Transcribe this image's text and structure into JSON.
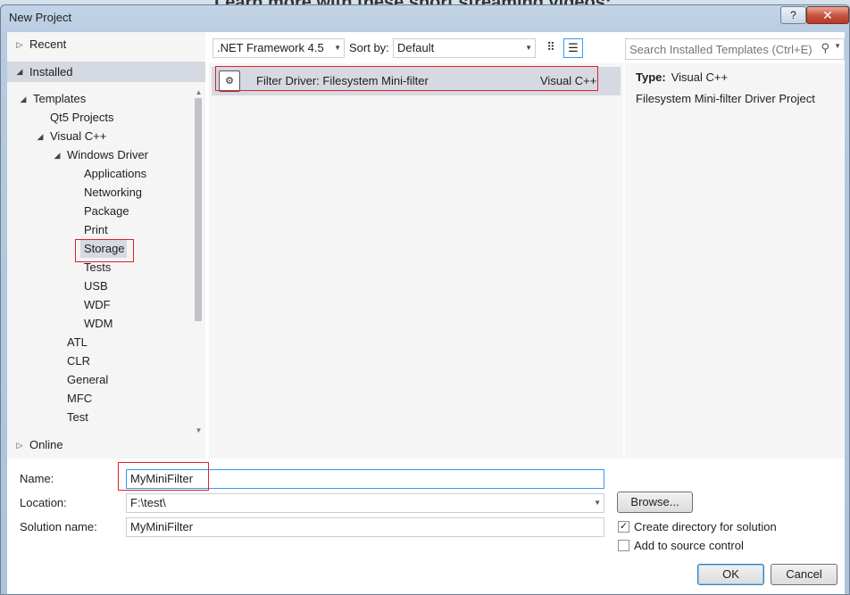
{
  "window": {
    "title": "New Project",
    "help_label": "?",
    "close_label": "✕"
  },
  "background": {
    "partial_text": "Learn more with these short streaming videos:"
  },
  "tree": {
    "recent": "Recent",
    "installed": "Installed",
    "online": "Online",
    "items": [
      {
        "label": "Templates",
        "expanded": true
      },
      {
        "label": "Qt5 Projects"
      },
      {
        "label": "Visual C++",
        "expanded": true
      },
      {
        "label": "Windows Driver",
        "expanded": true
      },
      {
        "label": "Applications"
      },
      {
        "label": "Networking"
      },
      {
        "label": "Package"
      },
      {
        "label": "Print"
      },
      {
        "label": "Storage",
        "selected": true
      },
      {
        "label": "Tests"
      },
      {
        "label": "USB"
      },
      {
        "label": "WDF"
      },
      {
        "label": "WDM"
      },
      {
        "label": "ATL"
      },
      {
        "label": "CLR"
      },
      {
        "label": "General"
      },
      {
        "label": "MFC"
      },
      {
        "label": "Test"
      }
    ]
  },
  "toolbar": {
    "framework": ".NET Framework 4.5",
    "sort_label": "Sort by:",
    "sort_value": "Default"
  },
  "templates": [
    {
      "name": "Filter Driver: Filesystem Mini-filter",
      "language": "Visual C++",
      "selected": true
    }
  ],
  "search": {
    "placeholder": "Search Installed Templates (Ctrl+E)"
  },
  "details": {
    "type_label": "Type:",
    "type_value": "Visual C++",
    "description": "Filesystem Mini-filter Driver Project"
  },
  "form": {
    "name_label": "Name:",
    "name_value": "MyMiniFilter",
    "location_label": "Location:",
    "location_value": "F:\\test\\",
    "solution_label": "Solution name:",
    "solution_value": "MyMiniFilter",
    "browse_label": "Browse...",
    "create_dir_label": "Create directory for solution",
    "create_dir_checked": true,
    "source_control_label": "Add to source control",
    "source_control_checked": false,
    "ok_label": "OK",
    "cancel_label": "Cancel"
  },
  "colors": {
    "highlight_box": "#e0202a",
    "selection": "#d5d9e2",
    "focus_border": "#3399ff"
  }
}
